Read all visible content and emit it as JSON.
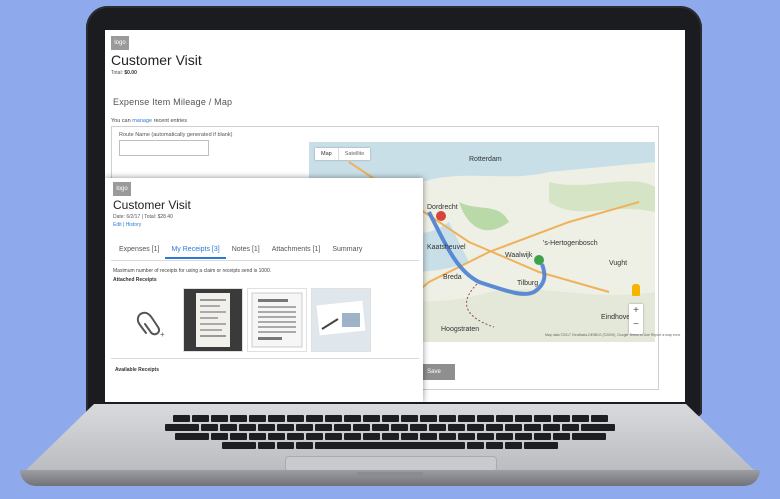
{
  "colors": {
    "background": "#8ea9ec",
    "accent": "#2d7ad6",
    "map_route": "#4b7fd1"
  },
  "back_app": {
    "logo": "logo",
    "title": "Customer Visit",
    "total_label": "Total:",
    "total_value": "$0.00",
    "breadcrumb": "Expense Item Mileage / Map",
    "manage_prefix": "You can",
    "manage_link": "manage",
    "manage_suffix": "recent entries",
    "route_label": "Route Name (automatically generated if blank)",
    "map_tabs": [
      "Map",
      "Satellite"
    ],
    "map_places": [
      "Rotterdam",
      "Dordrecht",
      "Kaatsheuvel",
      "'s-Hertogenbosch",
      "Waalwijk",
      "Breda",
      "Tilburg",
      "Eindhoven",
      "Hoogstraten",
      "Vught"
    ],
    "map_footer": "Map data ©2017 GeoBasis-DE/BKG (©2009), Google  Terms of Use  Report a map error",
    "save_label": "Save"
  },
  "card": {
    "logo": "logo",
    "title": "Customer Visit",
    "meta": "Date: 6/2/17  |  Total: $28.40",
    "links": "Edit  |  History",
    "tabs": [
      "Expenses [1]",
      "My Receipts [3]",
      "Notes [1]",
      "Attachments [1]",
      "Summary"
    ],
    "active_tab_index": 1,
    "max_line": "Maximum number of receipts for using a claim or receipts send is 1000.",
    "attached_heading": "Attached Receipts",
    "available_heading": "Available Receipts"
  }
}
